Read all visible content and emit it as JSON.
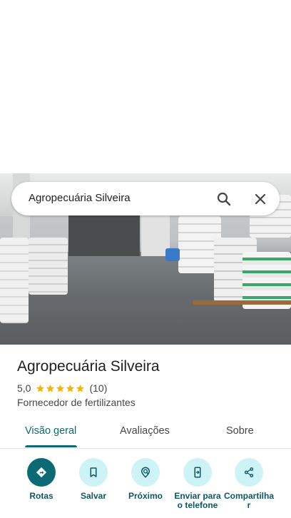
{
  "search": {
    "query": "Agropecuária Silveira"
  },
  "place": {
    "name": "Agropecuária Silveira",
    "rating": "5,0",
    "stars": 5,
    "review_count": "(10)",
    "category": "Fornecedor de fertilizantes"
  },
  "tabs": [
    {
      "label": "Visão geral",
      "active": true
    },
    {
      "label": "Avaliações",
      "active": false
    },
    {
      "label": "Sobre",
      "active": false
    }
  ],
  "actions": [
    {
      "label": "Rotas",
      "icon": "directions-icon"
    },
    {
      "label": "Salvar",
      "icon": "bookmark-icon"
    },
    {
      "label": "Próximo",
      "icon": "nearby-icon"
    },
    {
      "label": "Enviar para o telefone",
      "icon": "send-to-phone-icon"
    },
    {
      "label": "Compartilhar",
      "icon": "share-icon"
    }
  ],
  "colors": {
    "accent": "#0b6a73",
    "accent_light": "#cdf3f7",
    "star": "#f4b400"
  }
}
